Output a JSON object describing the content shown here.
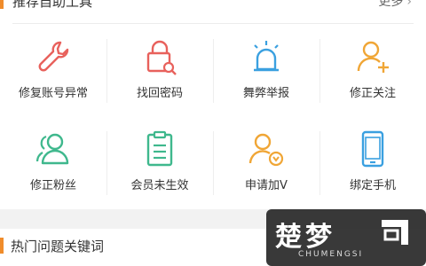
{
  "section": {
    "title": "推荐自助工具",
    "more_label": "更多"
  },
  "tools": [
    {
      "label": "修复账号异常",
      "icon": "wrench-icon",
      "color": "#e8615c"
    },
    {
      "label": "找回密码",
      "icon": "lock-icon",
      "color": "#e8615c"
    },
    {
      "label": "舞弊举报",
      "icon": "alarm-light-icon",
      "color": "#3aa0e0"
    },
    {
      "label": "修正关注",
      "icon": "add-user-icon",
      "color": "#f0a636"
    },
    {
      "label": "修正粉丝",
      "icon": "users-icon",
      "color": "#3fb88d"
    },
    {
      "label": "会员未生效",
      "icon": "clipboard-icon",
      "color": "#3fb88d"
    },
    {
      "label": "申请加V",
      "icon": "verified-user-icon",
      "color": "#f0a636"
    },
    {
      "label": "绑定手机",
      "icon": "phone-icon",
      "color": "#3aa0e0"
    }
  ],
  "hot_section": {
    "title": "热门问题关键词"
  },
  "watermark": {
    "main": "楚梦",
    "sub": "CHUMENGSI"
  }
}
